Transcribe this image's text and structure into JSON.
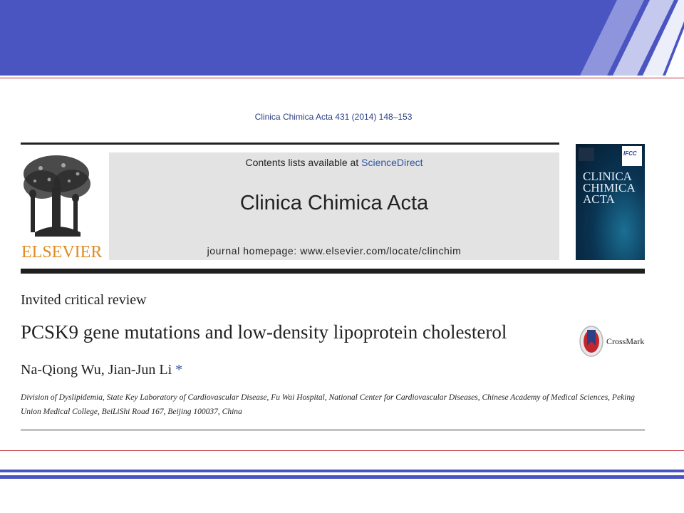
{
  "citation": "Clinica Chimica Acta 431 (2014) 148–153",
  "publisher": {
    "logo_text": "ELSEVIER"
  },
  "journal_header": {
    "contents_prefix": "Contents lists available at ",
    "contents_link": "ScienceDirect",
    "journal_name": "Clinica Chimica Acta",
    "homepage": "journal homepage: www.elsevier.com/locate/clinchim"
  },
  "cover": {
    "badge": "IFCC",
    "title_lines": [
      "CLINICA",
      "CHIMICA",
      "ACTA"
    ]
  },
  "article": {
    "type": "Invited critical review",
    "title": "PCSK9 gene mutations and low-density lipoprotein cholesterol",
    "authors": "Na-Qiong Wu, Jian-Jun Li",
    "corresponding_mark": "*",
    "affiliation": "Division of Dyslipidemia, State Key Laboratory of Cardiovascular Disease, Fu Wai Hospital, National Center for Cardiovascular Diseases, Chinese Academy of Medical Sciences, Peking Union Medical College, BeiLiShi Road 167, Beijing 100037, China"
  },
  "crossmark": {
    "label": "CrossMark"
  },
  "colors": {
    "banner": "#4a55c2",
    "accent_rule": "#c0303a",
    "link_blue": "#2c56a0",
    "elsevier_orange": "#e08a22"
  }
}
